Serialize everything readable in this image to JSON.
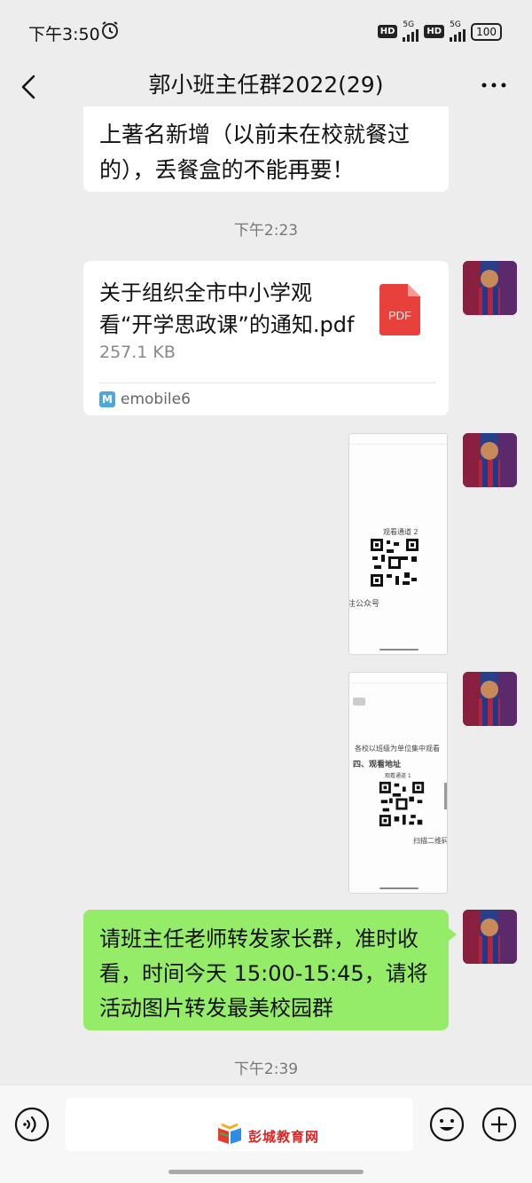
{
  "status_bar": {
    "time": "下午3:50",
    "network1": "5G",
    "network2": "5G",
    "hd_label": "HD",
    "battery": "100"
  },
  "header": {
    "title": "郭小班主任群2022(29)"
  },
  "messages": {
    "partial_text": "上著名新增（以前未在校就餐过的），丢餐盒的不能再要！",
    "timestamp1": "下午2:23",
    "file": {
      "name": "关于组织全市中小学观看“开学思政课”的通知.pdf",
      "size": "257.1 KB",
      "source": "emobile6",
      "type_label": "PDF",
      "source_icon": "M"
    },
    "image1": {
      "caption_top": "观看通道 2",
      "caption_bottom": "注公众号"
    },
    "image2": {
      "heading": "四、观看地址",
      "line1": "各校以班级为单位集中观看",
      "caption_mid": "观看通道 1",
      "caption_bottom": "扫描二维码"
    },
    "green_text": "请班主任老师转发家长群，准时收看，时间今天 15:00-15:45，请将活动图片转发最美校园群",
    "timestamp2": "下午2:39"
  },
  "input_bar": {
    "watermark": "彭城教育网"
  },
  "colors": {
    "background": "#ededed",
    "green_bubble": "#95ec69",
    "pdf_red": "#e8413c"
  }
}
